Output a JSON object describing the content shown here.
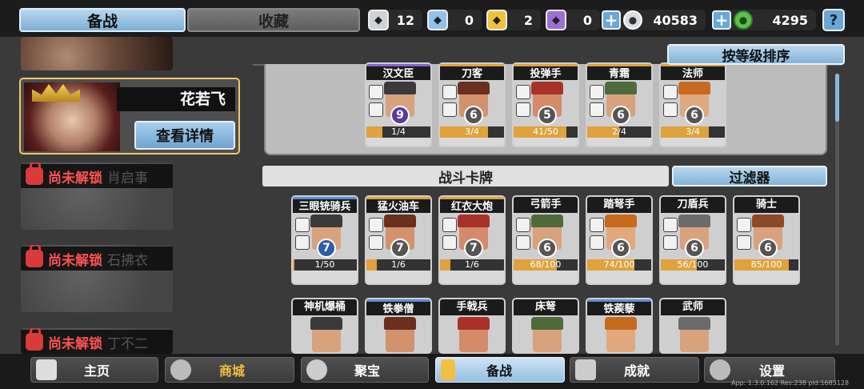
{
  "tabs": {
    "active": "备战",
    "inactive": "收藏"
  },
  "resources": [
    {
      "name": "silver-gem",
      "value": "12",
      "color": "#cfd3d8"
    },
    {
      "name": "blue-gem",
      "value": "0",
      "color": "#8fc3ef"
    },
    {
      "name": "gold-gem",
      "value": "2",
      "color": "#f0c23a"
    },
    {
      "name": "purple-gem",
      "value": "0",
      "color": "#9b6fd6"
    }
  ],
  "currency": [
    {
      "name": "silver-coin",
      "value": "40583"
    },
    {
      "name": "green-jade",
      "value": "4295"
    }
  ],
  "help_label": "?",
  "selected_hero": {
    "name": "花若飞",
    "detail_button": "查看详情"
  },
  "locked_heroes": [
    {
      "lock_text": "尚未解锁",
      "name": "肖启事"
    },
    {
      "lock_text": "尚未解锁",
      "name": "石拂衣"
    },
    {
      "lock_text": "尚未解锁",
      "name": "丁不二"
    }
  ],
  "sort_button": "按等级排序",
  "deck_cards": [
    {
      "name": "汉文臣",
      "cost": "9",
      "progress": "1/4",
      "rarity": "purple"
    },
    {
      "name": "刀客",
      "cost": "6",
      "progress": "3/4",
      "rarity": "gold"
    },
    {
      "name": "投弹手",
      "cost": "5",
      "progress": "41/50",
      "rarity": "gold"
    },
    {
      "name": "青霜",
      "cost": "6",
      "progress": "2/4",
      "rarity": "gold"
    },
    {
      "name": "法师",
      "cost": "6",
      "progress": "3/4",
      "rarity": "gold"
    }
  ],
  "battle_cards_title": "战斗卡牌",
  "filter_button": "过滤器",
  "battle_cards_row1": [
    {
      "name": "三眼铳骑兵",
      "cost": "7",
      "progress": "1/50",
      "rarity": "blue"
    },
    {
      "name": "猛火油车",
      "cost": "7",
      "progress": "1/6",
      "rarity": "gold"
    },
    {
      "name": "红衣大炮",
      "cost": "7",
      "progress": "1/6",
      "rarity": "gold"
    },
    {
      "name": "弓箭手",
      "cost": "6",
      "progress": "68/100",
      "rarity": "gray"
    },
    {
      "name": "踏弩手",
      "cost": "6",
      "progress": "74/100",
      "rarity": "gray"
    },
    {
      "name": "刀盾兵",
      "cost": "6",
      "progress": "56/100",
      "rarity": "gray"
    },
    {
      "name": "骑士",
      "cost": "6",
      "progress": "85/100",
      "rarity": "gray"
    }
  ],
  "battle_cards_row2": [
    {
      "name": "神机爆桶",
      "rarity": "gray"
    },
    {
      "name": "铁拳僧",
      "rarity": "blue"
    },
    {
      "name": "手戟兵",
      "rarity": "gray"
    },
    {
      "name": "床弩",
      "rarity": "gray"
    },
    {
      "name": "铁蒺藜",
      "rarity": "blue"
    },
    {
      "name": "武师",
      "rarity": "gray"
    }
  ],
  "nav": [
    {
      "label": "主页",
      "icon": "home-icon"
    },
    {
      "label": "商城",
      "icon": "shop-icon"
    },
    {
      "label": "聚宝",
      "icon": "treasure-icon"
    },
    {
      "label": "备战",
      "icon": "card-icon"
    },
    {
      "label": "成就",
      "icon": "achievement-icon"
    },
    {
      "label": "设置",
      "icon": "gear-icon"
    }
  ],
  "version_text": "App: 1.3.0.162 Res:238 pid:1683128"
}
